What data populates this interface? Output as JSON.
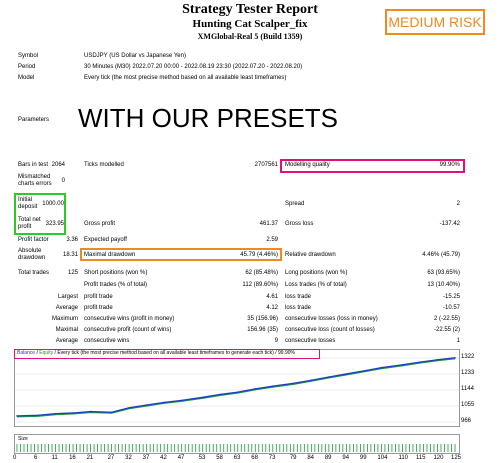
{
  "header": {
    "title": "Strategy Tester Report",
    "subtitle": "Hunting Cat Scalper_fix",
    "server": "XMGlobal-Real 5 (Build 1359)",
    "risk_badge": "MEDIUM RISK"
  },
  "meta": {
    "symbol_label": "Symbol",
    "symbol_value": "USDJPY (US Dollar vs Japanese Yen)",
    "period_label": "Period",
    "period_value": "30 Minutes (M30) 2022.07.20 00:00 - 2022.08.19 23:30 (2022.07.20 - 2022.08.20)",
    "model_label": "Model",
    "model_value": "Every tick (the most precise method based on all available least timeframes)",
    "parameters_label": "Parameters",
    "presets_text": "WITH OUR PRESETS"
  },
  "stats": {
    "bars_label": "Bars in test",
    "bars_value": "2064",
    "ticks_label": "Ticks modelled",
    "ticks_value": "2707561",
    "quality_label": "Modelling quality",
    "quality_value": "99.90%",
    "mismatch_label": "Mismatched charts errors",
    "mismatch_value": "0",
    "deposit_label": "Initial deposit",
    "deposit_value": "1000.00",
    "spread_label": "Spread",
    "spread_value": "2",
    "netprofit_label": "Total net profit",
    "netprofit_value": "323.95",
    "grossprofit_label": "Gross profit",
    "grossprofit_value": "461.37",
    "grossloss_label": "Gross loss",
    "grossloss_value": "-137.42",
    "pf_label": "Profit factor",
    "pf_value": "3.36",
    "payoff_label": "Expected payoff",
    "payoff_value": "2.59",
    "absdd_label": "Absolute drawdown",
    "absdd_value": "18.31",
    "maxdd_label": "Maximal drawdown",
    "maxdd_value": "45.79 (4.46%)",
    "reldd_label": "Relative drawdown",
    "reldd_value": "4.46% (45.79)",
    "trades_label": "Total trades",
    "trades_value": "125",
    "short_label": "Short positions (won %)",
    "short_value": "62 (85.48%)",
    "long_label": "Long positions (won %)",
    "long_value": "63 (93.65%)",
    "profit_trades_label": "Profit trades (% of total)",
    "profit_trades_value": "112 (89.60%)",
    "loss_trades_label": "Loss trades (% of total)",
    "loss_trades_value": "13 (10.40%)",
    "largest_label": "Largest",
    "largest_pt_label": "profit trade",
    "largest_pt_value": "4.61",
    "largest_lt_label": "loss trade",
    "largest_lt_value": "-15.25",
    "average_label": "Average",
    "average_pt_label": "profit trade",
    "average_pt_value": "4.12",
    "average_lt_label": "loss trade",
    "average_lt_value": "-10.57",
    "maximum_label": "Maximum",
    "max_cw_label": "consecutive wins (profit in money)",
    "max_cw_value": "35 (156.96)",
    "max_cl_label": "consecutive losses (loss in money)",
    "max_cl_value": "2 (-22.55)",
    "maximal_label": "Maximal",
    "mxl_cp_label": "consecutive profit (count of wins)",
    "mxl_cp_value": "156.96 (35)",
    "mxl_cl_label": "consecutive loss (count of losses)",
    "mxl_cl_value": "-22.55 (2)",
    "avg2_label": "Average",
    "avg_cw_label": "consecutive wins",
    "avg_cw_value": "9",
    "avg_cl_label": "consecutive losses",
    "avg_cl_value": "1"
  },
  "chart_legend": {
    "balance": "Balance",
    "sep1": " / ",
    "equity": "Equity",
    "rest": " / Every tick (the most precise method based on all available least timeframes to generate each tick)",
    "quality": " / 99.90%"
  },
  "chart_data": {
    "type": "line",
    "y_ticks": [
      "1322",
      "1233",
      "1144",
      "1055",
      "966"
    ],
    "ylim": [
      966,
      1322
    ],
    "x_ticks": [
      "0",
      "6",
      "11",
      "16",
      "21",
      "27",
      "32",
      "37",
      "42",
      "47",
      "53",
      "58",
      "63",
      "68",
      "73",
      "79",
      "84",
      "89",
      "94",
      "99",
      "104",
      "110",
      "115",
      "120",
      "125"
    ],
    "size_label": "Size",
    "series": [
      {
        "name": "Balance",
        "x": [
          0,
          6,
          11,
          16,
          21,
          27,
          32,
          37,
          42,
          47,
          53,
          58,
          63,
          68,
          73,
          79,
          84,
          89,
          94,
          99,
          104,
          110,
          115,
          120,
          125
        ],
        "values": [
          1000,
          1003,
          1012,
          1016,
          1024,
          1020,
          1045,
          1060,
          1075,
          1086,
          1103,
          1119,
          1132,
          1150,
          1165,
          1181,
          1198,
          1216,
          1233,
          1250,
          1268,
          1284,
          1299,
          1312,
          1323
        ]
      }
    ],
    "colors": {
      "balance": "#1f3fbf",
      "equity": "#1a9a3a"
    }
  },
  "colors": {
    "risk": "#f08a1e",
    "pink": "#e0117f",
    "green": "#2ecc1f",
    "orange": "#f08a1e"
  }
}
